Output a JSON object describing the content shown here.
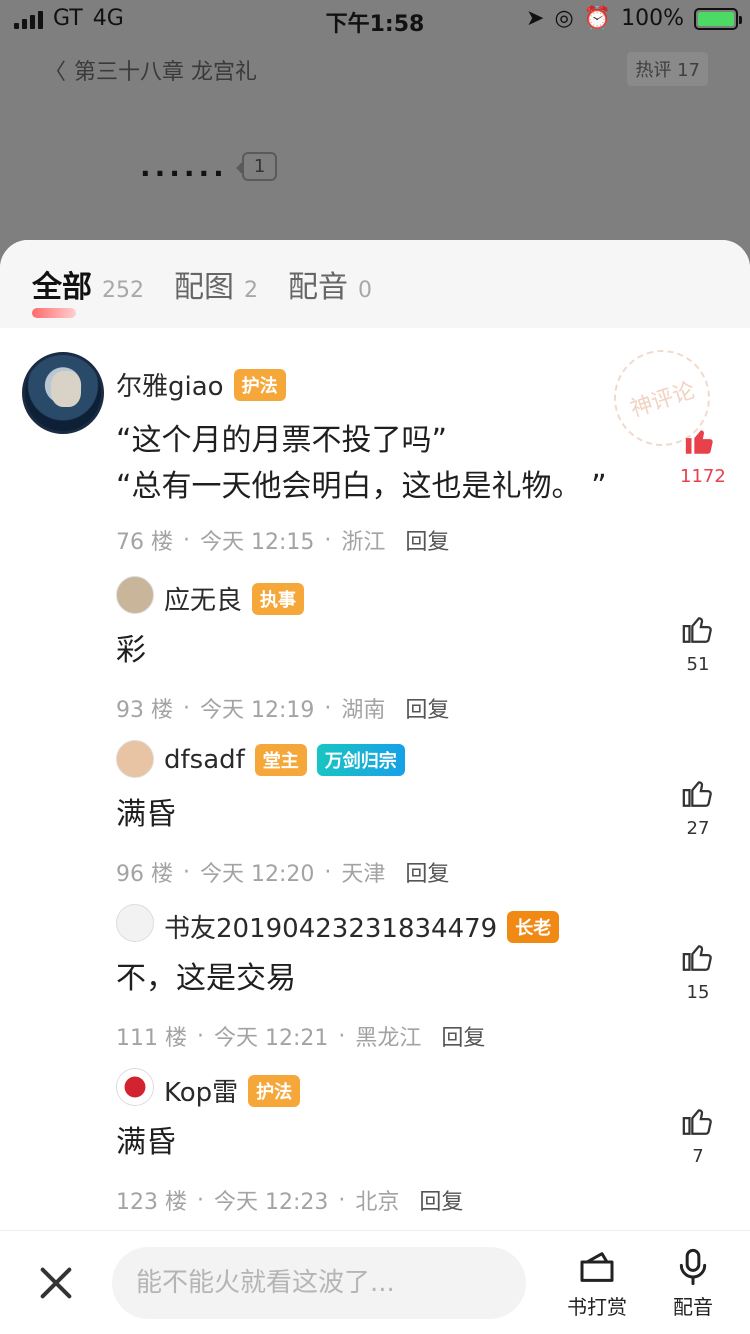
{
  "status": {
    "carrier": "GT",
    "network": "4G",
    "time": "下午1:58",
    "battery": "100%"
  },
  "reader": {
    "chapter_title": "第三十八章 龙宫礼",
    "hot_label": "热评 17",
    "dots": "......",
    "paragraph_count": "1"
  },
  "tabs": [
    {
      "label": "全部",
      "count": "252"
    },
    {
      "label": "配图",
      "count": "2"
    },
    {
      "label": "配音",
      "count": "0"
    }
  ],
  "stamp": {
    "text": "神评论"
  },
  "comments": [
    {
      "user": "尔雅giao",
      "badges": [
        "护法"
      ],
      "lines": [
        "“这个月的月票不投了吗”",
        "“总有一天他会明白，这也是礼物。 ”"
      ],
      "floor": "76 楼",
      "time": "今天 12:15",
      "place": "浙江",
      "reply": "回复",
      "likes": "1172"
    },
    {
      "user": "应无良",
      "badges": [
        "执事"
      ],
      "lines": [
        "彩"
      ],
      "floor": "93 楼",
      "time": "今天 12:19",
      "place": "湖南",
      "reply": "回复",
      "likes": "51"
    },
    {
      "user": "dfsadf",
      "badges": [
        "堂主",
        "万剑归宗"
      ],
      "lines": [
        "满昏"
      ],
      "floor": "96 楼",
      "time": "今天 12:20",
      "place": "天津",
      "reply": "回复",
      "likes": "27"
    },
    {
      "user": "书友20190423231834479",
      "badges": [
        "长老"
      ],
      "lines": [
        "不，这是交易"
      ],
      "floor": "111 楼",
      "time": "今天 12:21",
      "place": "黑龙江",
      "reply": "回复",
      "likes": "15"
    },
    {
      "user": "Kop雷",
      "badges": [
        "护法"
      ],
      "lines": [
        "满昏"
      ],
      "floor": "123 楼",
      "time": "今天 12:23",
      "place": "北京",
      "reply": "回复",
      "likes": "7"
    }
  ],
  "bottom": {
    "placeholder": "能不能火就看这波了...",
    "reward_label": "书打赏",
    "voice_label": "配音"
  },
  "colors": {
    "accent": "#e8414c",
    "badge_orange": "#f6a73a",
    "badge_teal": "#19c5c2"
  }
}
